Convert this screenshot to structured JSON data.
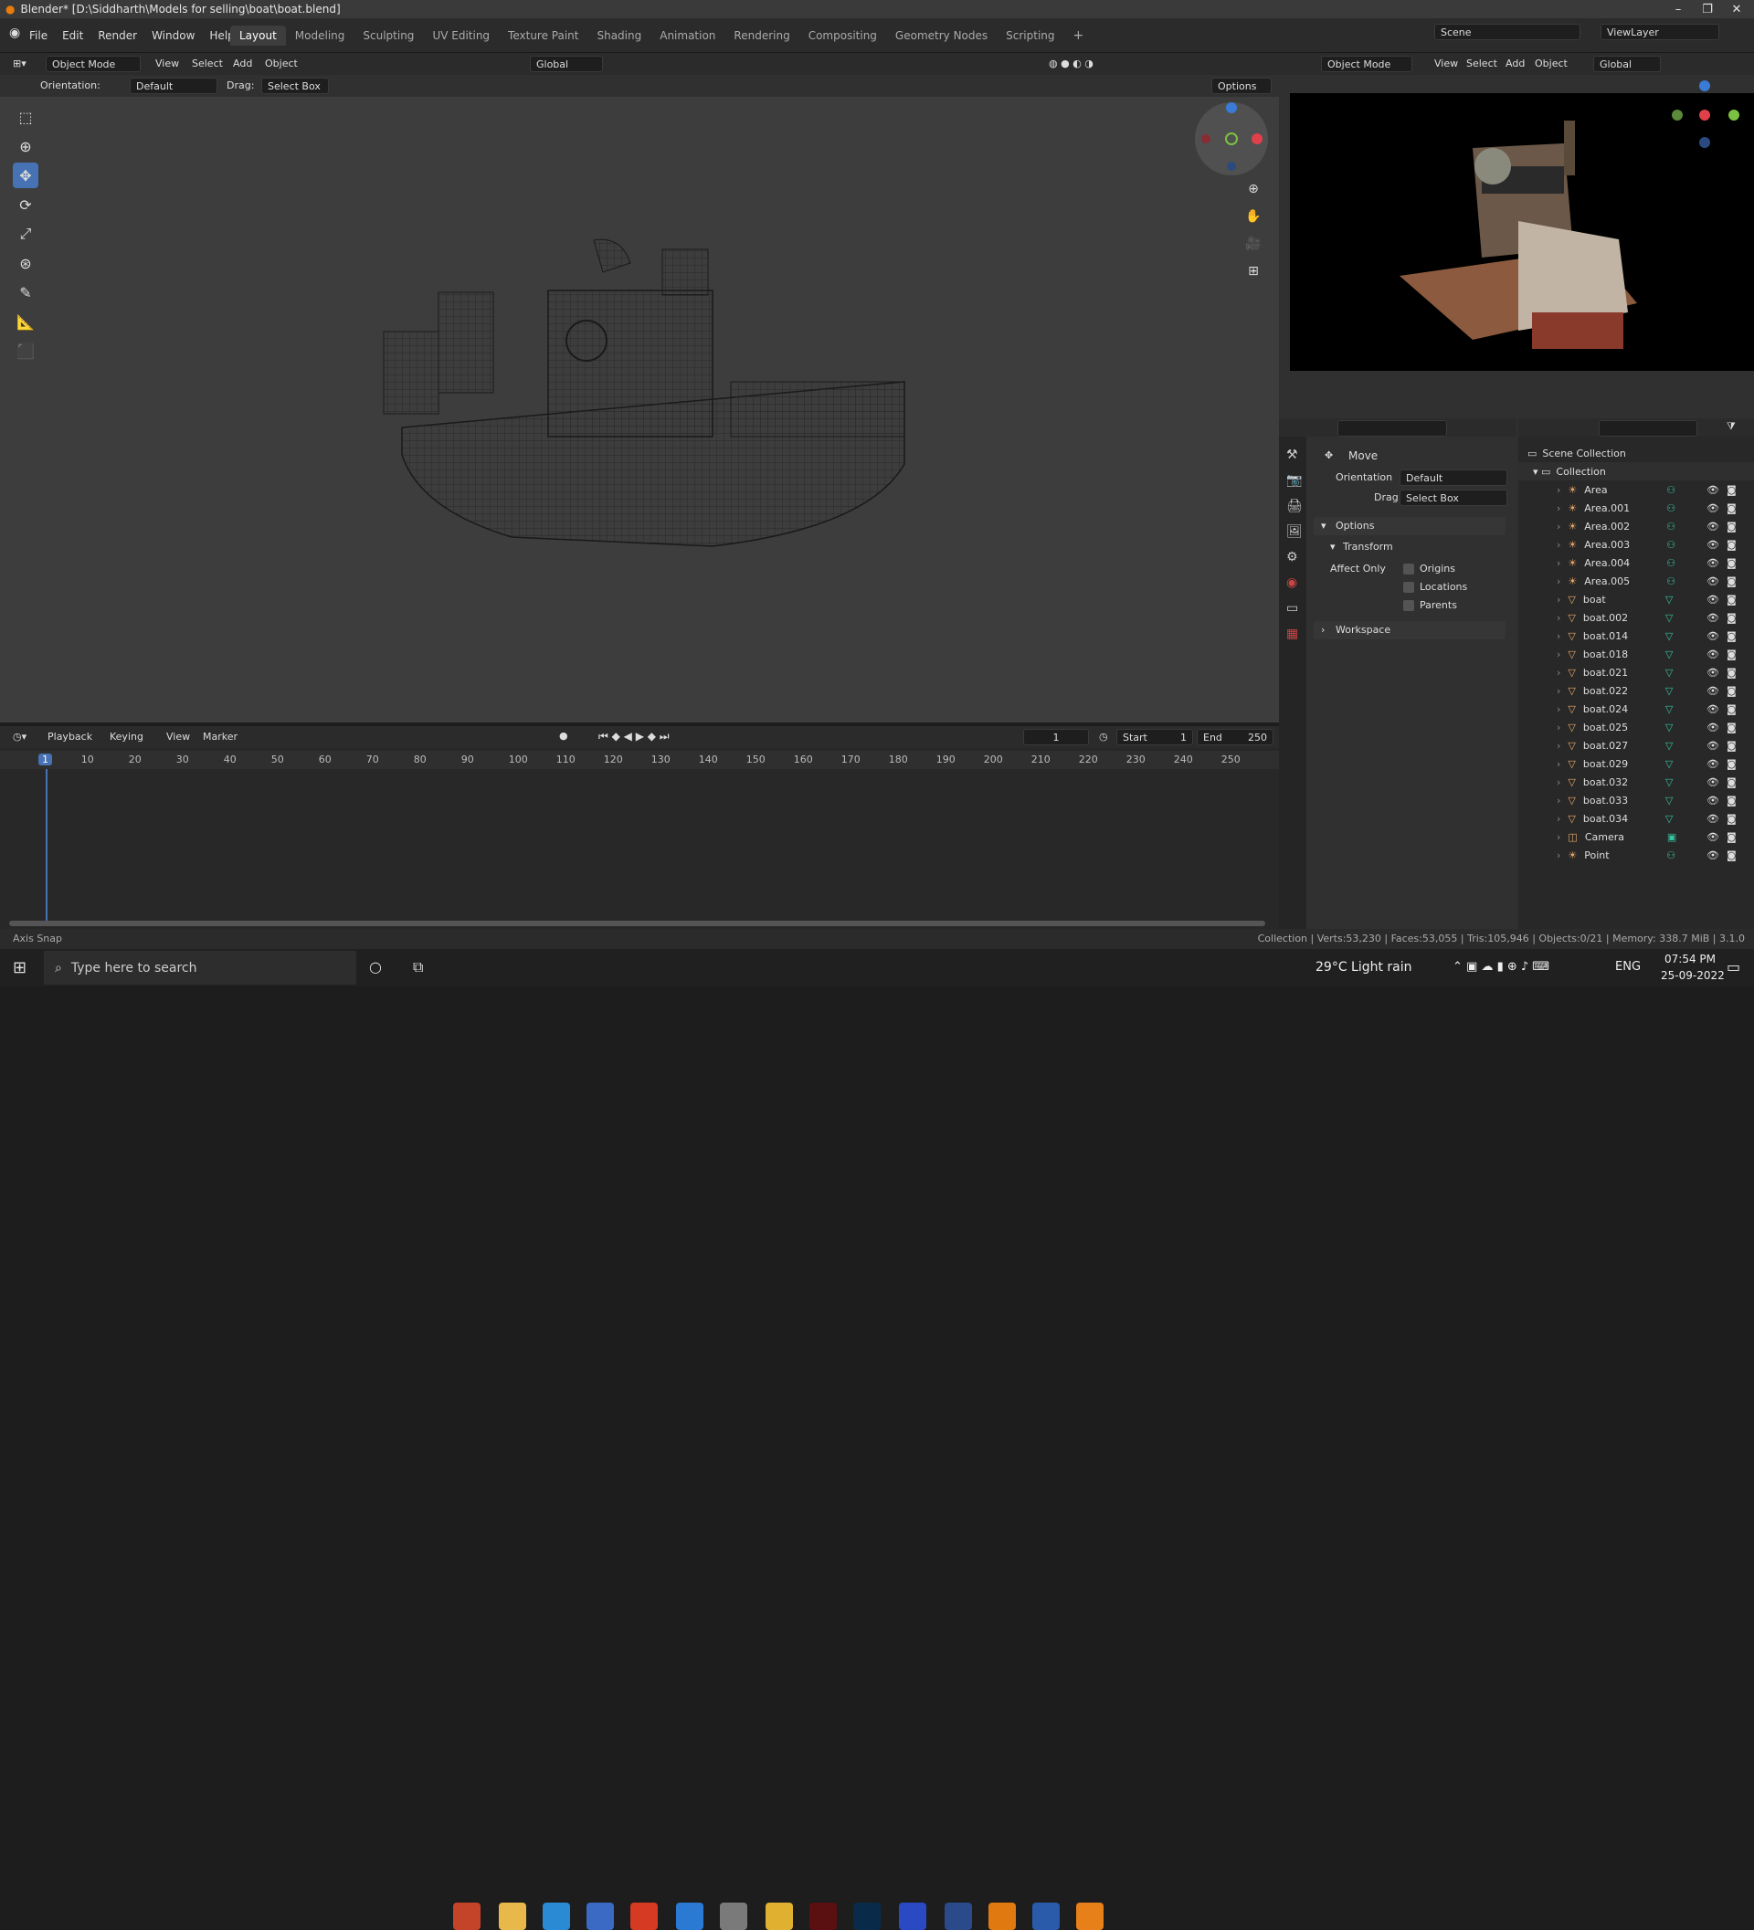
{
  "window": {
    "title": "Blender* [D:\\Siddharth\\Models for selling\\boat\\boat.blend]"
  },
  "menu": [
    "File",
    "Edit",
    "Render",
    "Window",
    "Help"
  ],
  "workspaces": [
    "Layout",
    "Modeling",
    "Sculpting",
    "UV Editing",
    "Texture Paint",
    "Shading",
    "Animation",
    "Rendering",
    "Compositing",
    "Geometry Nodes",
    "Scripting"
  ],
  "scene": {
    "name": "Scene",
    "view_layer": "ViewLayer"
  },
  "viewport": {
    "mode": "Object Mode",
    "menus": [
      "View",
      "Select",
      "Add",
      "Object"
    ],
    "transform": "Global",
    "orientation_label": "Orientation:",
    "orientation": "Default",
    "drag_label": "Drag:",
    "drag": "Select Box",
    "options": "Options"
  },
  "render_view": {
    "mode": "Object Mode",
    "menus": [
      "View",
      "Select",
      "Add",
      "Object"
    ],
    "transform": "Global"
  },
  "properties": {
    "tool": "Move",
    "orientation_label": "Orientation",
    "orientation": "Default",
    "drag_label": "Drag",
    "drag": "Select Box",
    "options": "Options",
    "transform": "Transform",
    "affect_only": "Affect Only",
    "origins": "Origins",
    "locations": "Locations",
    "parents": "Parents",
    "workspace": "Workspace"
  },
  "outliner": {
    "root": "Scene Collection",
    "collection": "Collection",
    "items": [
      {
        "name": "Area",
        "type": "light"
      },
      {
        "name": "Area.001",
        "type": "light"
      },
      {
        "name": "Area.002",
        "type": "light"
      },
      {
        "name": "Area.003",
        "type": "light"
      },
      {
        "name": "Area.004",
        "type": "light"
      },
      {
        "name": "Area.005",
        "type": "light"
      },
      {
        "name": "boat",
        "type": "mesh"
      },
      {
        "name": "boat.002",
        "type": "mesh"
      },
      {
        "name": "boat.014",
        "type": "mesh"
      },
      {
        "name": "boat.018",
        "type": "mesh"
      },
      {
        "name": "boat.021",
        "type": "mesh"
      },
      {
        "name": "boat.022",
        "type": "mesh"
      },
      {
        "name": "boat.024",
        "type": "mesh"
      },
      {
        "name": "boat.025",
        "type": "mesh"
      },
      {
        "name": "boat.027",
        "type": "mesh"
      },
      {
        "name": "boat.029",
        "type": "mesh"
      },
      {
        "name": "boat.032",
        "type": "mesh"
      },
      {
        "name": "boat.033",
        "type": "mesh"
      },
      {
        "name": "boat.034",
        "type": "mesh"
      },
      {
        "name": "Camera",
        "type": "camera"
      },
      {
        "name": "Point",
        "type": "light"
      }
    ]
  },
  "timeline": {
    "menus": [
      "Playback",
      "Keying",
      "View",
      "Marker"
    ],
    "frame": "1",
    "start_label": "Start",
    "start": "1",
    "end_label": "End",
    "end": "250",
    "ticks": [
      "1",
      "10",
      "20",
      "30",
      "40",
      "50",
      "60",
      "70",
      "80",
      "90",
      "100",
      "110",
      "120",
      "130",
      "140",
      "150",
      "160",
      "170",
      "180",
      "190",
      "200",
      "210",
      "220",
      "230",
      "240",
      "250"
    ]
  },
  "status": {
    "left": "Axis Snap",
    "right": "Collection | Verts:53,230 | Faces:53,055 | Tris:105,946 | Objects:0/21 | Memory: 338.7 MiB | 3.1.0"
  },
  "taskbar": {
    "search": "Type here to search",
    "weather": "29°C  Light rain",
    "lang": "ENG",
    "time": "07:54 PM",
    "date": "25-09-2022"
  },
  "colors": {
    "accent": "#4772b3",
    "light": "#e8a96a",
    "mesh": "#35c2a0"
  }
}
